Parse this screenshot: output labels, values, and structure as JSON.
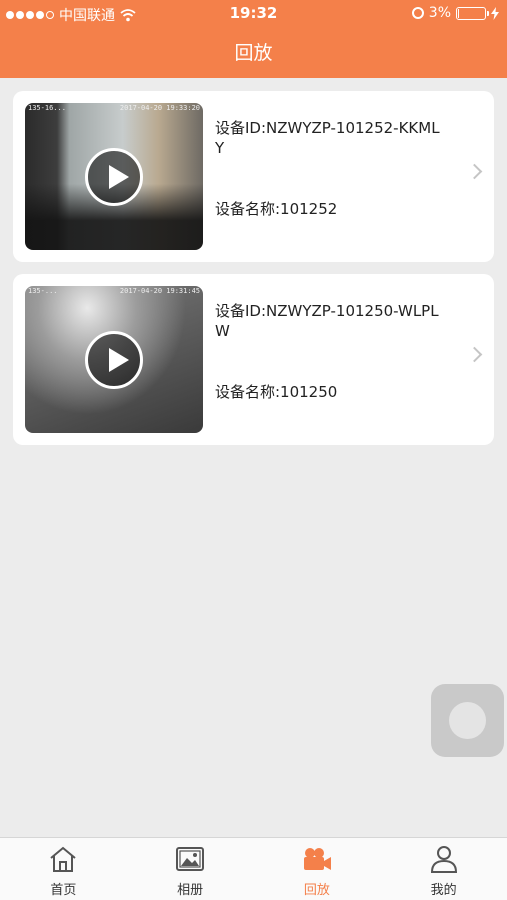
{
  "status_bar": {
    "carrier": "中国联通",
    "time": "19:32",
    "battery": "3%",
    "battery_level": 0.03
  },
  "header": {
    "title": "回放"
  },
  "devices": [
    {
      "id_label": "设备ID:NZWYZP-101252-KKMLY",
      "name_label": "设备名称:101252",
      "osd_left": "135-16...",
      "osd_right": "2017-04-20 19:33:20"
    },
    {
      "id_label": "设备ID:NZWYZP-101250-WLPLW",
      "name_label": "设备名称:101250",
      "osd_left": "135-...",
      "osd_right": "2017-04-20 19:31:45"
    }
  ],
  "tabs": [
    {
      "label": "首页",
      "icon": "home-icon",
      "active": false
    },
    {
      "label": "相册",
      "icon": "album-icon",
      "active": false
    },
    {
      "label": "回放",
      "icon": "video-camera-icon",
      "active": true
    },
    {
      "label": "我的",
      "icon": "user-icon",
      "active": false
    }
  ],
  "colors": {
    "accent": "#f4804a",
    "background": "#ececec",
    "inactive_icon": "#555555"
  }
}
